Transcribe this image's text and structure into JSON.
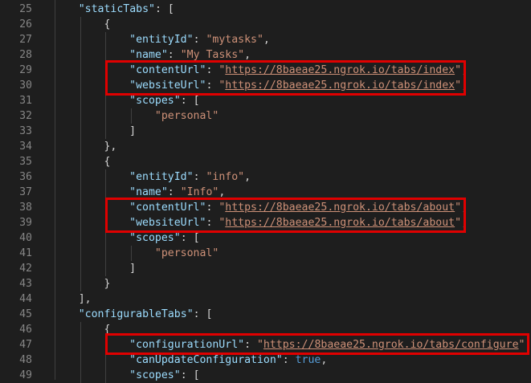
{
  "editor": {
    "lines": [
      {
        "num": "25",
        "indent": 4,
        "tokens": [
          [
            "k",
            "\"staticTabs\""
          ],
          [
            "p",
            ": ["
          ]
        ]
      },
      {
        "num": "26",
        "indent": 8,
        "tokens": [
          [
            "p",
            "{"
          ]
        ]
      },
      {
        "num": "27",
        "indent": 12,
        "tokens": [
          [
            "k",
            "\"entityId\""
          ],
          [
            "p",
            ": "
          ],
          [
            "s",
            "\"mytasks\""
          ],
          [
            "p",
            ","
          ]
        ]
      },
      {
        "num": "28",
        "indent": 12,
        "tokens": [
          [
            "k",
            "\"name\""
          ],
          [
            "p",
            ": "
          ],
          [
            "s",
            "\"My Tasks\""
          ],
          [
            "p",
            ","
          ]
        ]
      },
      {
        "num": "29",
        "indent": 12,
        "tokens": [
          [
            "k",
            "\"contentUrl\""
          ],
          [
            "p",
            ": "
          ],
          [
            "s",
            "\""
          ],
          [
            "u",
            "https://8baeae25.ngrok.io/tabs/index"
          ],
          [
            "s",
            "\""
          ],
          [
            "p",
            ","
          ]
        ]
      },
      {
        "num": "30",
        "indent": 12,
        "tokens": [
          [
            "k",
            "\"websiteUrl\""
          ],
          [
            "p",
            ": "
          ],
          [
            "s",
            "\""
          ],
          [
            "u",
            "https://8baeae25.ngrok.io/tabs/index"
          ],
          [
            "s",
            "\""
          ],
          [
            "p",
            ","
          ]
        ]
      },
      {
        "num": "31",
        "indent": 12,
        "tokens": [
          [
            "k",
            "\"scopes\""
          ],
          [
            "p",
            ": ["
          ]
        ]
      },
      {
        "num": "32",
        "indent": 16,
        "tokens": [
          [
            "s",
            "\"personal\""
          ]
        ]
      },
      {
        "num": "33",
        "indent": 12,
        "tokens": [
          [
            "p",
            "]"
          ]
        ]
      },
      {
        "num": "34",
        "indent": 8,
        "tokens": [
          [
            "p",
            "},"
          ]
        ]
      },
      {
        "num": "35",
        "indent": 8,
        "tokens": [
          [
            "p",
            "{"
          ]
        ]
      },
      {
        "num": "36",
        "indent": 12,
        "tokens": [
          [
            "k",
            "\"entityId\""
          ],
          [
            "p",
            ": "
          ],
          [
            "s",
            "\"info\""
          ],
          [
            "p",
            ","
          ]
        ]
      },
      {
        "num": "37",
        "indent": 12,
        "tokens": [
          [
            "k",
            "\"name\""
          ],
          [
            "p",
            ": "
          ],
          [
            "s",
            "\"Info\""
          ],
          [
            "p",
            ","
          ]
        ]
      },
      {
        "num": "38",
        "indent": 12,
        "tokens": [
          [
            "k",
            "\"contentUrl\""
          ],
          [
            "p",
            ": "
          ],
          [
            "s",
            "\""
          ],
          [
            "u",
            "https://8baeae25.ngrok.io/tabs/about"
          ],
          [
            "s",
            "\""
          ],
          [
            "p",
            ","
          ]
        ]
      },
      {
        "num": "39",
        "indent": 12,
        "tokens": [
          [
            "k",
            "\"websiteUrl\""
          ],
          [
            "p",
            ": "
          ],
          [
            "s",
            "\""
          ],
          [
            "u",
            "https://8baeae25.ngrok.io/tabs/about"
          ],
          [
            "s",
            "\""
          ],
          [
            "p",
            ","
          ]
        ]
      },
      {
        "num": "40",
        "indent": 12,
        "tokens": [
          [
            "k",
            "\"scopes\""
          ],
          [
            "p",
            ": ["
          ]
        ]
      },
      {
        "num": "41",
        "indent": 16,
        "tokens": [
          [
            "s",
            "\"personal\""
          ]
        ]
      },
      {
        "num": "42",
        "indent": 12,
        "tokens": [
          [
            "p",
            "]"
          ]
        ]
      },
      {
        "num": "43",
        "indent": 8,
        "tokens": [
          [
            "p",
            "}"
          ]
        ]
      },
      {
        "num": "44",
        "indent": 4,
        "tokens": [
          [
            "p",
            "],"
          ]
        ]
      },
      {
        "num": "45",
        "indent": 4,
        "tokens": [
          [
            "k",
            "\"configurableTabs\""
          ],
          [
            "p",
            ": ["
          ]
        ]
      },
      {
        "num": "46",
        "indent": 8,
        "tokens": [
          [
            "p",
            "{"
          ]
        ]
      },
      {
        "num": "47",
        "indent": 12,
        "tokens": [
          [
            "k",
            "\"configurationUrl\""
          ],
          [
            "p",
            ": "
          ],
          [
            "s",
            "\""
          ],
          [
            "u",
            "https://8baeae25.ngrok.io/tabs/configure"
          ],
          [
            "s",
            "\""
          ],
          [
            "p",
            ","
          ]
        ]
      },
      {
        "num": "48",
        "indent": 12,
        "tokens": [
          [
            "k",
            "\"canUpdateConfiguration\""
          ],
          [
            "p",
            ": "
          ],
          [
            "b",
            "true"
          ],
          [
            "p",
            ","
          ]
        ]
      },
      {
        "num": "49",
        "indent": 12,
        "tokens": [
          [
            "k",
            "\"scopes\""
          ],
          [
            "p",
            ": ["
          ]
        ]
      }
    ],
    "colors": {
      "background": "#1e1e1e",
      "line_number": "#858585",
      "key": "#9cdcfe",
      "string": "#ce9178",
      "punctuation": "#d4d4d4",
      "boolean": "#569cd6",
      "highlight_box": "#e00000"
    }
  }
}
